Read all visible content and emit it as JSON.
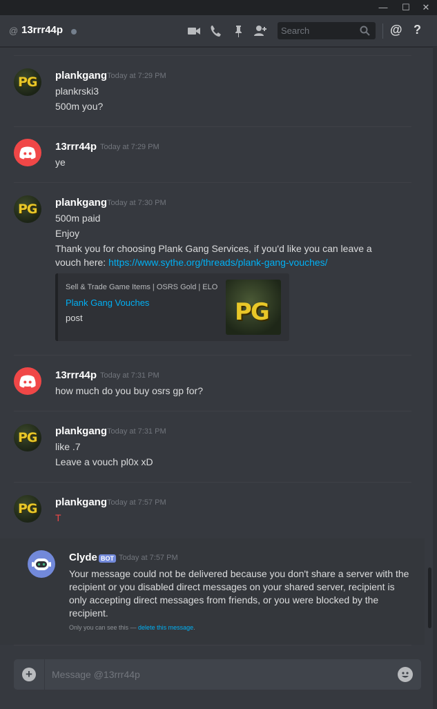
{
  "window": {
    "minimize_glyph": "—",
    "maximize_glyph": "☐",
    "close_glyph": "✕"
  },
  "header": {
    "at_symbol": "@",
    "recipient": "13rrr44p",
    "search_placeholder": "Search",
    "icons": [
      "video-call-icon",
      "voice-call-icon",
      "pin-icon",
      "add-friend-icon",
      "search-icon",
      "mention-icon",
      "help-icon"
    ],
    "help_glyph": "?",
    "mention_glyph": "@"
  },
  "messages": [
    {
      "author": "plankgang",
      "time": "Today at 7:29 PM",
      "avatar": "PG",
      "lines": [
        "plankrski3",
        "500m you?"
      ]
    },
    {
      "author": "13rrr44p",
      "time": "Today at 7:29 PM",
      "lines": [
        "ye"
      ]
    },
    {
      "author": "plankgang",
      "time": "Today at 7:30 PM",
      "avatar": "PG",
      "lines": [
        "500m paid",
        "Enjoy",
        "Thank you for choosing Plank Gang Services, if you'd like you can leave a"
      ],
      "link_prefix": "vouch here: ",
      "link": "https://www.sythe.org/threads/plank-gang-vouches/",
      "embed": {
        "provider": "Sell & Trade Game Items | OSRS Gold | ELO",
        "title": "Plank Gang Vouches",
        "description": "post",
        "thumb_text": "PG"
      }
    },
    {
      "author": "13rrr44p",
      "time": "Today at 7:31 PM",
      "lines": [
        "how much do you buy osrs gp for?"
      ]
    },
    {
      "author": "plankgang",
      "time": "Today at 7:31 PM",
      "avatar": "PG",
      "lines": [
        "like .7",
        "Leave a vouch pl0x xD"
      ]
    },
    {
      "author": "plankgang",
      "time": "Today at 7:57 PM",
      "avatar": "PG",
      "lines": [
        "T"
      ]
    }
  ],
  "clyde": {
    "author": "Clyde",
    "tag": "BOT",
    "time": "Today at 7:57 PM",
    "text": "Your message could not be delivered because you don't share a server with the recipient or you disabled direct messages on your shared server, recipient is only accepting direct messages from friends, or you were blocked by the recipient.",
    "note_prefix": "Only you can see this — ",
    "note_link": "delete this message",
    "note_suffix": "."
  },
  "composer": {
    "placeholder": "Message @13rrr44p",
    "add_glyph": "+"
  },
  "colors": {
    "background": "#36393f",
    "titlebar": "#202225",
    "link": "#00b0f4",
    "error_text": "#f04747",
    "discord_red": "#f04747",
    "blurple": "#7289da",
    "pg_yellow": "#e8c728"
  }
}
